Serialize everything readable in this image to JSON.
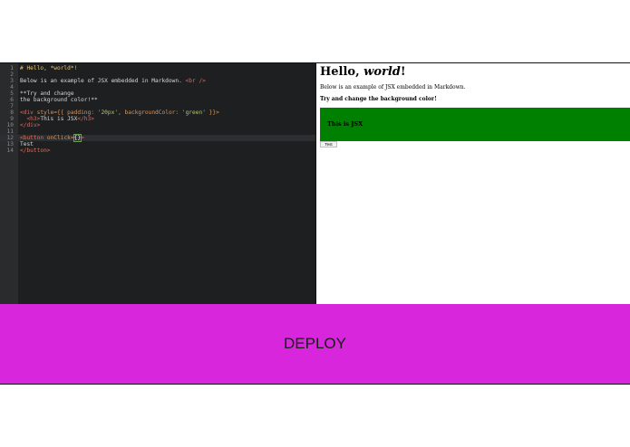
{
  "editor": {
    "lines": [
      {
        "n": "1",
        "segs": [
          {
            "t": "# Hello, *world*!",
            "c": "head"
          }
        ]
      },
      {
        "n": "2",
        "segs": []
      },
      {
        "n": "3",
        "segs": [
          {
            "t": "Below is an example of JSX embedded in Markdown. ",
            "c": "text"
          },
          {
            "t": "<br />",
            "c": "tag"
          }
        ]
      },
      {
        "n": "4",
        "segs": []
      },
      {
        "n": "5",
        "segs": [
          {
            "t": "**Try and change",
            "c": "text"
          }
        ]
      },
      {
        "n": "6",
        "segs": [
          {
            "t": "the background color!**",
            "c": "text"
          }
        ]
      },
      {
        "n": "7",
        "segs": []
      },
      {
        "n": "8",
        "segs": [
          {
            "t": "<div ",
            "c": "tag"
          },
          {
            "t": "style",
            "c": "attr"
          },
          {
            "t": "={{ padding: ",
            "c": "attr"
          },
          {
            "t": "'20px'",
            "c": "str"
          },
          {
            "t": ", backgroundColor: ",
            "c": "attr"
          },
          {
            "t": "'green'",
            "c": "str"
          },
          {
            "t": " }}>",
            "c": "attr"
          }
        ]
      },
      {
        "n": "9",
        "segs": [
          {
            "t": "  <h3>",
            "c": "tag"
          },
          {
            "t": "This is JSX",
            "c": "text"
          },
          {
            "t": "</h3>",
            "c": "tag"
          }
        ]
      },
      {
        "n": "10",
        "segs": [
          {
            "t": "</div>",
            "c": "tag"
          }
        ]
      },
      {
        "n": "11",
        "segs": []
      },
      {
        "n": "12",
        "segs": [
          {
            "t": "<button ",
            "c": "tag"
          },
          {
            "t": "onClick",
            "c": "attr"
          },
          {
            "t": "=",
            "c": "attr"
          },
          {
            "t": "{}",
            "c": "cur"
          },
          {
            "t": ">",
            "c": "tag"
          }
        ]
      },
      {
        "n": "13",
        "segs": [
          {
            "t": "Test",
            "c": "text"
          }
        ]
      },
      {
        "n": "14",
        "segs": [
          {
            "t": "</button>",
            "c": "tag"
          }
        ]
      }
    ],
    "active_line": "12"
  },
  "preview": {
    "title_prefix": "Hello, ",
    "title_em": "world",
    "title_suffix": "!",
    "description": "Below is an example of JSX embedded in Markdown.",
    "bold_text": "Try and change the background color!",
    "green_box_heading": "This is JSX",
    "green_box_color": "#008000",
    "button_label": "Test"
  },
  "deploy": {
    "label": "DEPLOY",
    "color": "#d726db"
  }
}
